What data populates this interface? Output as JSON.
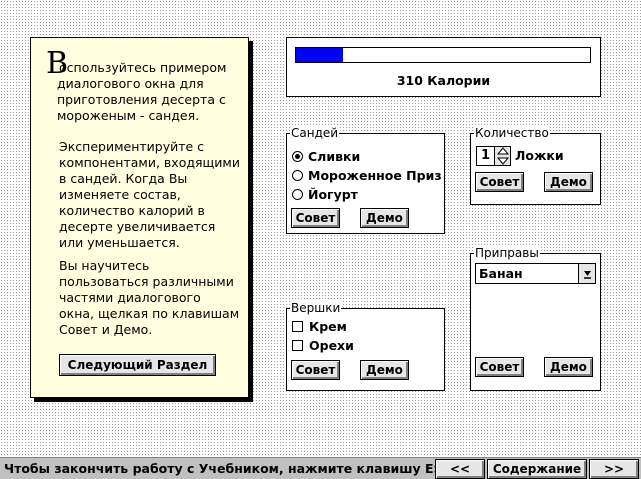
{
  "intro": {
    "drop_cap": "В",
    "para1_lines": [
      "оспользуйтесь примером",
      "диалогового окна для",
      "приготовления десерта с",
      "мороженым - сандея."
    ],
    "para2_lines": [
      "Экспериментируйте с",
      "компонентами, входящими",
      "в сандей. Когда Вы",
      "изменяете состав,",
      "количество калорий в",
      "десерте увеличивается",
      "или уменьшается."
    ],
    "para3_lines": [
      "Вы научитесь",
      "пользоваться различными",
      "частями диалогового",
      "окна, щелкая по клавишам",
      "Совет и Демо."
    ],
    "next_section_label": "Следующий Раздел"
  },
  "calories": {
    "progress_fraction": 0.16,
    "label": "310 Калории"
  },
  "sundae": {
    "legend": "Сандей",
    "options": [
      "Сливки",
      "Мороженное Приз",
      "Йогурт"
    ],
    "selected_index": 0,
    "tip_label": "Совет",
    "demo_label": "Демо"
  },
  "quantity": {
    "legend": "Количество",
    "value": "1",
    "unit": "Ложки",
    "tip_label": "Совет",
    "demo_label": "Демо"
  },
  "toppings": {
    "legend": "Вершки",
    "options": [
      "Крем",
      "Орехи"
    ],
    "tip_label": "Совет",
    "demo_label": "Демо"
  },
  "condiments": {
    "legend": "Приправы",
    "selected": "Банан",
    "tip_label": "Совет",
    "demo_label": "Демо"
  },
  "status_bar": {
    "text": "Чтобы закончить работу с Учебником, нажмите клавишу ESC.",
    "prev_label": "<<",
    "contents_label": "Содержание",
    "next_label": ">>"
  }
}
